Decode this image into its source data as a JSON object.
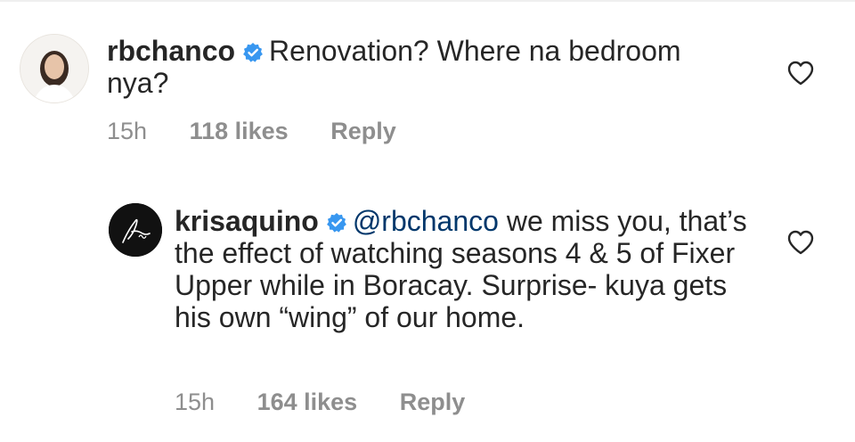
{
  "comments": [
    {
      "username": "rbchanco",
      "text": "Renovation? Where na bedroom nya?",
      "time": "15h",
      "likes": "118 likes",
      "reply": "Reply"
    },
    {
      "username": "krisaquino",
      "mention": "@rbchanco",
      "text": " we miss you, that’s the effect of watching seasons 4 & 5 of Fixer Upper while in Boracay. Surprise- kuya gets his own “wing” of our home.",
      "time": "15h",
      "likes": "164 likes",
      "reply": "Reply"
    }
  ],
  "colors": {
    "text": "#262626",
    "meta": "#8e8e8e",
    "verified": "#3897f0",
    "mention": "#00376b"
  },
  "icons": {
    "verified": "verified-badge-icon",
    "like": "heart-outline-icon"
  }
}
